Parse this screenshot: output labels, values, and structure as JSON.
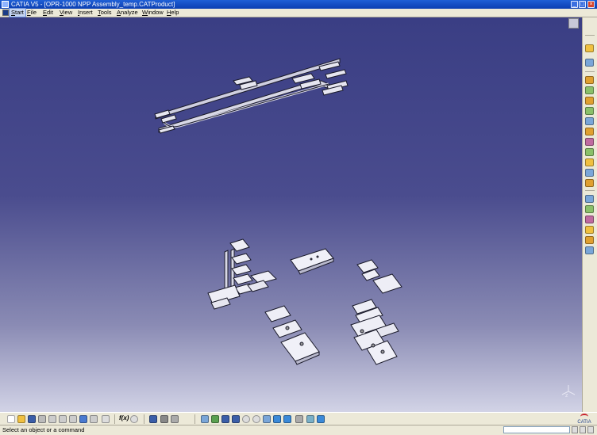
{
  "window": {
    "title": "CATIA V5 - [OPR-1000 NPP Assembly_temp.CATProduct]",
    "controls": [
      "minimize-icon",
      "maximize-icon",
      "close-icon"
    ]
  },
  "menu": {
    "items": [
      "Start",
      "File",
      "Edit",
      "View",
      "Insert",
      "Tools",
      "Analyze",
      "Window",
      "Help"
    ],
    "active": "Start"
  },
  "viewport": {
    "background_top": "#3a3e84",
    "background_bottom": "#d2d3e6",
    "part_color": "#eeeef6",
    "axis_label": "z"
  },
  "right_toolbar": {
    "icons": [
      "select-arrow-icon",
      "fly-mode-icon",
      "product-icon",
      "component-icon",
      "part-icon",
      "existing-component-icon",
      "replace-component-icon",
      "graph-tree-reorder-icon",
      "generate-numbering-icon",
      "selective-load-icon",
      "manage-representations-icon",
      "multi-instantiation-icon",
      "fast-multi-instantiation-icon",
      "manipulation-icon",
      "snap-icon",
      "explode-icon",
      "stop-manipulate-icon",
      "clash-analysis-icon",
      "sectioning-icon"
    ],
    "icon_colors": [
      "#f0c040",
      "#7aa6d8",
      "#e0a030",
      "#8ac06a",
      "#c06aa0"
    ]
  },
  "bottom_toolbar": {
    "groups": [
      [
        "new-icon",
        "open-icon",
        "save-icon",
        "print-icon",
        "cut-icon",
        "copy-icon",
        "paste-icon",
        "undo-icon",
        "redo-icon",
        "whats-this-icon"
      ],
      [
        "formula-icon",
        "knowledge-icon"
      ],
      [
        "catalog-icon",
        "select-set-icon",
        "display-mode-icon"
      ],
      [
        "fly-icon",
        "fit-all-icon",
        "pan-icon",
        "rotate-icon",
        "zoom-in-icon",
        "zoom-out-icon",
        "normal-view-icon",
        "isometric-view-icon",
        "render-style-icon",
        "hide-show-icon",
        "swap-space-icon"
      ]
    ],
    "formula_label": "f(x)",
    "brand": "CATIA"
  },
  "status": {
    "message": "Select an object or a command",
    "command_input_value": ""
  }
}
